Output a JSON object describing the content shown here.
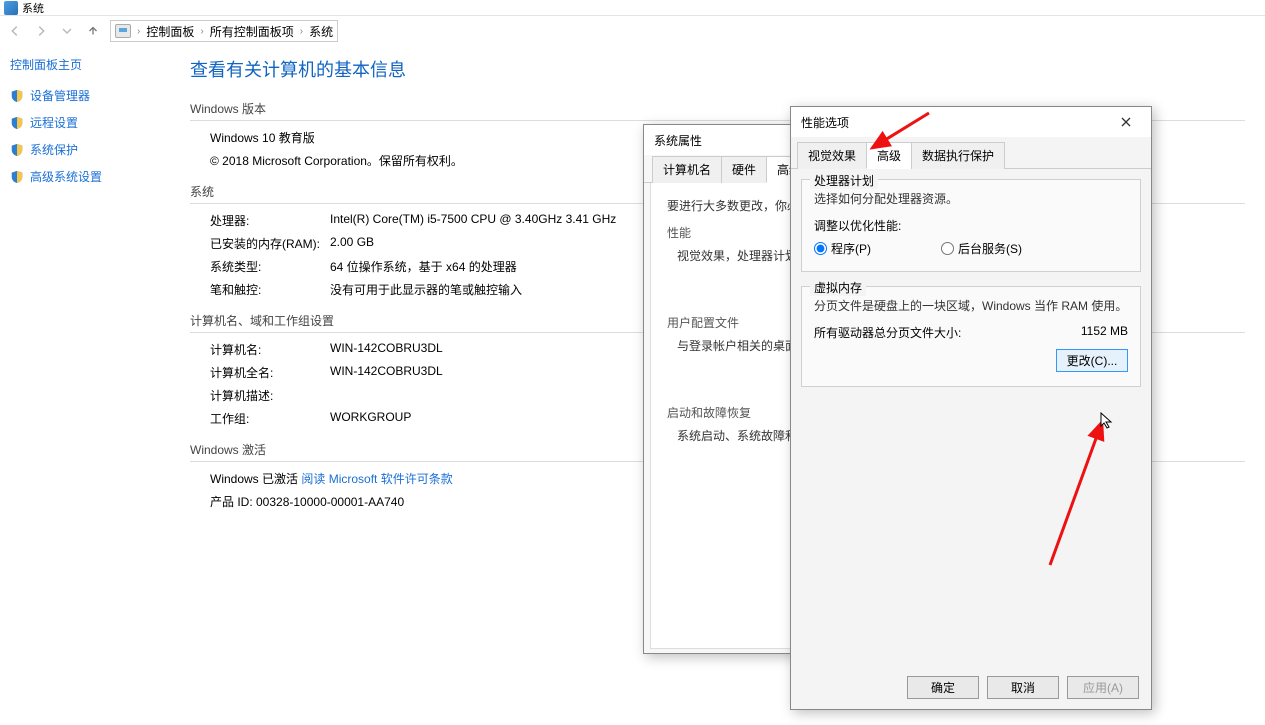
{
  "window": {
    "title": "系统"
  },
  "breadcrumb": {
    "item1": "控制面板",
    "item2": "所有控制面板项",
    "item3": "系统"
  },
  "sidebar": {
    "home": "控制面板主页",
    "items": [
      {
        "label": "设备管理器"
      },
      {
        "label": "远程设置"
      },
      {
        "label": "系统保护"
      },
      {
        "label": "高级系统设置"
      }
    ]
  },
  "content": {
    "page_title": "查看有关计算机的基本信息",
    "edition_hdr": "Windows 版本",
    "edition": "Windows 10 教育版",
    "copyright": "© 2018 Microsoft Corporation。保留所有权利。",
    "system_hdr": "系统",
    "cpu_k": "处理器:",
    "cpu_v": "Intel(R) Core(TM) i5-7500 CPU @ 3.40GHz   3.41 GHz",
    "ram_k": "已安装的内存(RAM):",
    "ram_v": "2.00 GB",
    "type_k": "系统类型:",
    "type_v": "64 位操作系统，基于 x64 的处理器",
    "pen_k": "笔和触控:",
    "pen_v": "没有可用于此显示器的笔或触控输入",
    "computer_hdr": "计算机名、域和工作组设置",
    "cname_k": "计算机名:",
    "cname_v": "WIN-142COBRU3DL",
    "fullname_k": "计算机全名:",
    "fullname_v": "WIN-142COBRU3DL",
    "desc_k": "计算机描述:",
    "desc_v": "",
    "workgroup_k": "工作组:",
    "workgroup_v": "WORKGROUP",
    "activation_hdr": "Windows 激活",
    "activation_text": "Windows 已激活  ",
    "activation_link": "阅读 Microsoft 软件许可条款",
    "product_id": "产品 ID: 00328-10000-00001-AA740"
  },
  "sysprop": {
    "title": "系统属性",
    "tabs": {
      "t1": "计算机名",
      "t2": "硬件",
      "t3": "高级"
    },
    "note": "要进行大多数更改，你必",
    "perf_hdr": "性能",
    "perf_desc": "视觉效果，处理器计划，",
    "profile_hdr": "用户配置文件",
    "profile_desc": "与登录帐户相关的桌面设",
    "startup_hdr": "启动和故障恢复",
    "startup_desc": "系统启动、系统故障和调"
  },
  "perf": {
    "title": "性能选项",
    "tabs": {
      "t1": "视觉效果",
      "t2": "高级",
      "t3": "数据执行保护"
    },
    "sched_legend": "处理器计划",
    "sched_desc": "选择如何分配处理器资源。",
    "adjust_label": "调整以优化性能:",
    "radio_programs": "程序(P)",
    "radio_services": "后台服务(S)",
    "vm_legend": "虚拟内存",
    "vm_desc": "分页文件是硬盘上的一块区域，Windows 当作 RAM 使用。",
    "vm_total_label": "所有驱动器总分页文件大小:",
    "vm_total_value": "1152 MB",
    "btn_change": "更改(C)...",
    "btn_ok": "确定",
    "btn_cancel": "取消",
    "btn_apply": "应用(A)"
  }
}
